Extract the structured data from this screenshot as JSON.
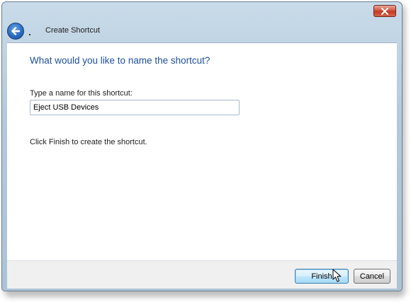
{
  "wizard": {
    "title": "Create Shortcut",
    "heading": "What would you like to name the shortcut?",
    "field_label": "Type a name for this shortcut:",
    "name_value": "Eject USB Devices",
    "hint": "Click Finish to create the shortcut."
  },
  "buttons": {
    "finish": "Finish",
    "cancel": "Cancel"
  },
  "icons": {
    "back": "back-arrow-icon",
    "close": "close-icon",
    "cursor": "mouse-pointer-icon"
  },
  "colors": {
    "heading": "#1f4f9a",
    "close_button": "#c23b22",
    "back_button": "#2a6cc4",
    "finish_border": "#3c7fb1"
  }
}
